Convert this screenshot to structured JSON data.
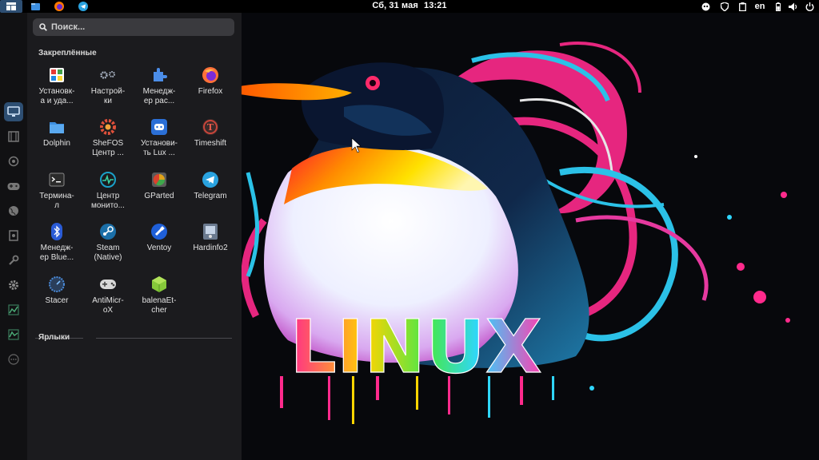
{
  "topbar": {
    "clock": {
      "day": "Сб, 31 мая",
      "time": "13:21"
    },
    "language": "en",
    "left_icons": [
      "activities-icon",
      "files-icon",
      "firefox-icon",
      "telegram-icon"
    ],
    "right_icons": [
      "bug-icon",
      "vpn-shield-icon",
      "clipboard-icon",
      "battery-icon",
      "volume-icon",
      "power-icon"
    ]
  },
  "dock": {
    "items": [
      {
        "name": "desktop",
        "icon": "monitor-icon",
        "active": true
      },
      {
        "name": "multimedia",
        "icon": "film-icon",
        "active": false
      },
      {
        "name": "graphics",
        "icon": "brush-icon",
        "active": false
      },
      {
        "name": "games",
        "icon": "gamepad-icon",
        "active": false
      },
      {
        "name": "internet",
        "icon": "globe-icon",
        "active": false
      },
      {
        "name": "office",
        "icon": "document-icon",
        "active": false
      },
      {
        "name": "development",
        "icon": "wrench-icon",
        "active": false
      },
      {
        "name": "settings",
        "icon": "gear-icon",
        "active": false
      },
      {
        "name": "system",
        "icon": "chart-icon",
        "active": false
      },
      {
        "name": "utilities",
        "icon": "chart2-icon",
        "active": false
      },
      {
        "name": "other",
        "icon": "more-icon",
        "active": false
      }
    ]
  },
  "menu": {
    "search_placeholder": "Поиск...",
    "pinned_title": "Закреплённые",
    "shortcuts_title": "Ярлыки",
    "apps": [
      {
        "label": "Установк-\nа и уда...",
        "icon": "software-install-icon"
      },
      {
        "label": "Настрой-\nки",
        "icon": "settings-icon"
      },
      {
        "label": "Менедж-\nер рас...",
        "icon": "extensions-icon"
      },
      {
        "label": "Firefox",
        "icon": "firefox-icon"
      },
      {
        "label": "Dolphin",
        "icon": "folder-icon"
      },
      {
        "label": "SheFOS\nЦентр ...",
        "icon": "shefos-icon"
      },
      {
        "label": "Установи-\nть Lux ...",
        "icon": "lux-icon"
      },
      {
        "label": "Timeshift",
        "icon": "timeshift-icon"
      },
      {
        "label": "Термина-\nл",
        "icon": "terminal-icon"
      },
      {
        "label": "Центр\nмонито...",
        "icon": "monitor-center-icon"
      },
      {
        "label": "GParted",
        "icon": "gparted-icon"
      },
      {
        "label": "Telegram",
        "icon": "telegram-icon"
      },
      {
        "label": "Менедж-\nер Blue...",
        "icon": "bluetooth-icon"
      },
      {
        "label": "Steam\n(Native)",
        "icon": "steam-icon"
      },
      {
        "label": "Ventoy",
        "icon": "ventoy-icon"
      },
      {
        "label": "Hardinfo2",
        "icon": "hardinfo-icon"
      },
      {
        "label": "Stacer",
        "icon": "stacer-icon"
      },
      {
        "label": "AntiMicr-\noX",
        "icon": "gamepad-icon"
      },
      {
        "label": "balenaEt-\ncher",
        "icon": "etcher-icon"
      }
    ]
  },
  "wallpaper": {
    "text": "LINUX",
    "colors": {
      "bg": "#07080c",
      "magenta": "#ff2a8c",
      "cyan": "#2fd6ff",
      "yellow": "#ffd400",
      "green": "#46e84a"
    }
  }
}
